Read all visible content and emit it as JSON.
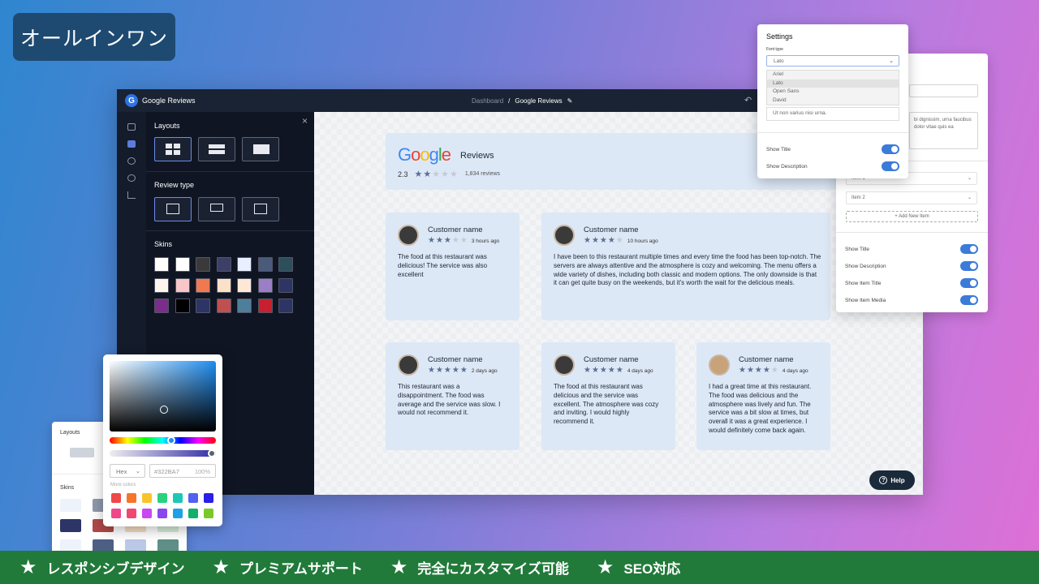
{
  "badge": "オールインワン",
  "app": {
    "title": "Google Reviews",
    "breadcrumb": {
      "dashboard": "Dashboard",
      "separator": "/",
      "current": "Google Reviews"
    },
    "panel": {
      "layouts": "Layouts",
      "review_type": "Review type",
      "skins": "Skins",
      "close": "×"
    },
    "header": {
      "logo": "Google",
      "reviews_label": "Reviews",
      "rating": "2.3",
      "review_count": "1,834 reviews",
      "stars_filled": 2,
      "stars_total": 5
    },
    "reviews": [
      {
        "name": "Customer name",
        "stars": 3,
        "time": "3 hours ago",
        "text": "The food at this restaurant was delicious! The service was also excellent"
      },
      {
        "name": "Customer name",
        "stars": 4,
        "time": "10 hours ago",
        "text": "I have been to this restaurant multiple times and every time the food has been top-notch. The servers are always attentive and the atmosphere is cozy and welcoming. The menu offers a wide variety of dishes, including both classic and modern options. The only downside is that it can get quite busy on the weekends, but it's worth the wait for the delicious meals."
      },
      {
        "name": "Customer name",
        "stars": 5,
        "time": "2 days ago",
        "text": "This restaurant was a disappointment. The food was average and the service was slow. I would not recommend it."
      },
      {
        "name": "Customer name",
        "stars": 5,
        "time": "4 days ago",
        "text": "The food at this restaurant was delicious and the service was excellent. The atmosphere was cozy and inviting. I would highly recommend it."
      },
      {
        "name": "Customer name",
        "stars": 4,
        "time": "4 days ago",
        "text": "I had a great time at this restaurant. The food was delicious and the atmosphere was lively and fun. The service was a bit slow at times, but overall it was a great experience. I would definitely come back again."
      }
    ],
    "help": "Help",
    "skins": [
      "#ffffff",
      "#ffffff",
      "#3a3a3a",
      "#3d3f66",
      "#e8efff",
      "#4a5a7a",
      "#2d4f5c",
      "#fdf6ec",
      "#f7c6c6",
      "#ef7a52",
      "#fbe1c7",
      "#fde8d6",
      "#9a7fc7",
      "#2d3566",
      "#7b2d8a",
      "#000000",
      "#2c3566",
      "#c05050",
      "#4e7f9a",
      "#c8202e",
      "#2c3566"
    ]
  },
  "settings": {
    "title": "Settings",
    "font_type_label": "Font type",
    "font_selected": "Lato",
    "font_options": [
      "Ariel",
      "Lato",
      "Open Sans",
      "David"
    ],
    "textarea": "Ut non varius nisi urna.",
    "show_title": "Show Title",
    "show_description": "Show Description"
  },
  "settings2": {
    "textarea_text": "bi dignissim, urna faucibus dolor vitae quis ea",
    "items": [
      "Item 1",
      "Item 2"
    ],
    "add_item": "+ Add New Item",
    "toggles": [
      "Show Title",
      "Show Description",
      "Show Item Title",
      "Show Item Media"
    ]
  },
  "color_picker": {
    "format": "Hex",
    "hex_value": "#322BA7",
    "alpha": "100%",
    "more_colors": "More colors",
    "swatches_row1": [
      "#f04747",
      "#f7742b",
      "#f7c52b",
      "#2bd17e",
      "#1fc7b7",
      "#5461f0",
      "#2a1fe6"
    ],
    "swatches_row2": [
      "#f0478a",
      "#f04770",
      "#c847f0",
      "#8a47f0",
      "#1fa0e6",
      "#12b06a",
      "#7ac92b"
    ]
  },
  "mini": {
    "layouts": "Layouts",
    "skins": "Skins"
  },
  "features": [
    "レスポンシブデザイン",
    "プレミアムサポート",
    "完全にカスタマイズ可能",
    "SEO対応"
  ]
}
